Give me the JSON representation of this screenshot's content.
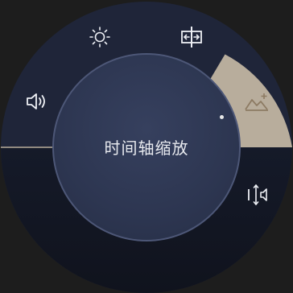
{
  "dial": {
    "center_label": "时间轴缩放",
    "selected_item": "image-adjust",
    "colors": {
      "background": "#1d1d1d",
      "ring": "#1f2539",
      "ring_lower": "#141826",
      "selected_segment": "#b8ad9c",
      "center": "#2d3651",
      "center_border": "#4d5777",
      "icon": "#eef0f5",
      "selected_icon": "#8d7b63"
    },
    "items": [
      {
        "icon": "brightness-icon"
      },
      {
        "icon": "horizontal-move-icon"
      },
      {
        "icon": "volume-icon"
      },
      {
        "icon": "image-adjust-icon"
      },
      {
        "icon": "vertical-audio-move-icon"
      }
    ]
  }
}
